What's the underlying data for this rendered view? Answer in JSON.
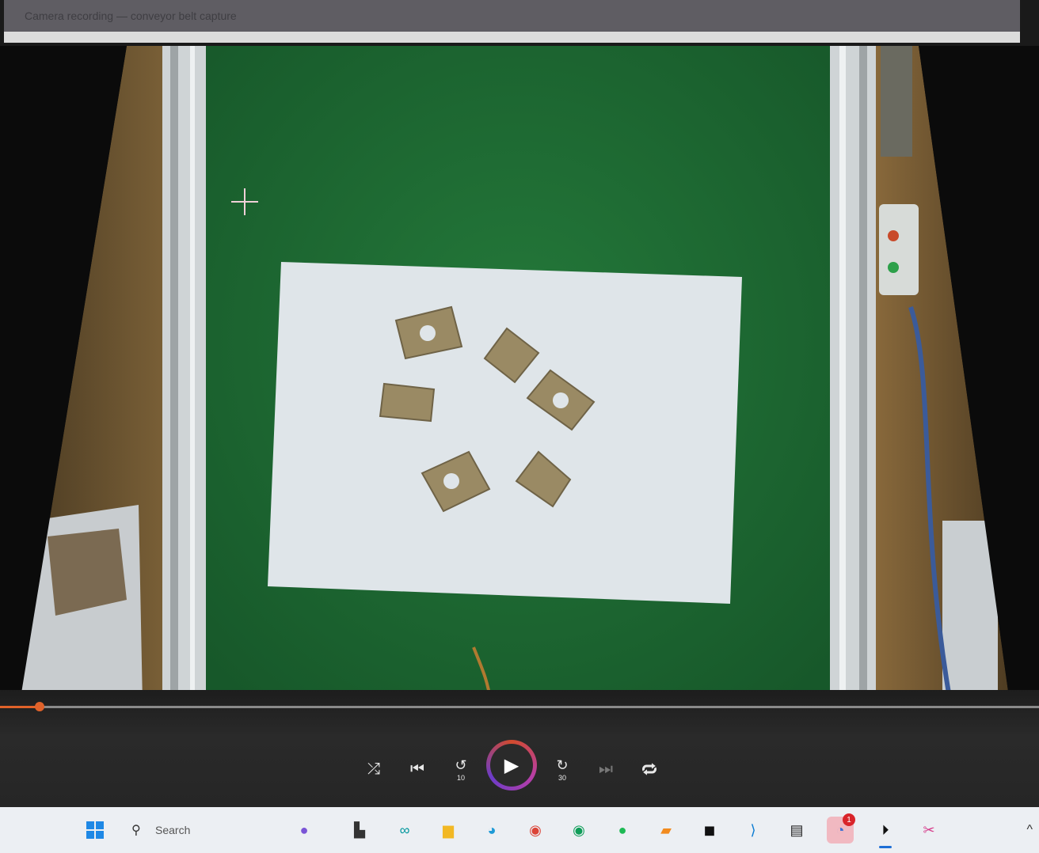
{
  "window": {
    "title": "Camera recording — conveyor belt capture"
  },
  "player": {
    "progress_fraction": 0.038,
    "controls": {
      "shuffle": "shuffle-icon",
      "previous": "previous-icon",
      "back": "10",
      "play": "play-icon",
      "forward": "30",
      "next": "next-icon",
      "repeat": "repeat-off-icon"
    }
  },
  "taskbar": {
    "search_placeholder": "Search",
    "apps": [
      {
        "name": "start-icon"
      },
      {
        "name": "copilot-icon"
      },
      {
        "name": "task-view-icon"
      },
      {
        "name": "arduino-icon"
      },
      {
        "name": "file-explorer-icon"
      },
      {
        "name": "edge-icon"
      },
      {
        "name": "chrome-icon"
      },
      {
        "name": "chrome-beta-icon"
      },
      {
        "name": "spotify-icon"
      },
      {
        "name": "sublime-icon"
      },
      {
        "name": "app-icon"
      },
      {
        "name": "vscode-icon"
      },
      {
        "name": "terminal-icon"
      },
      {
        "name": "teams-icon",
        "badge": "1"
      },
      {
        "name": "media-player-icon"
      },
      {
        "name": "snipping-icon"
      }
    ],
    "colors": {
      "accent": "#e0622a",
      "belt": "#1e6b2d",
      "paper": "#dfe5e9"
    }
  }
}
